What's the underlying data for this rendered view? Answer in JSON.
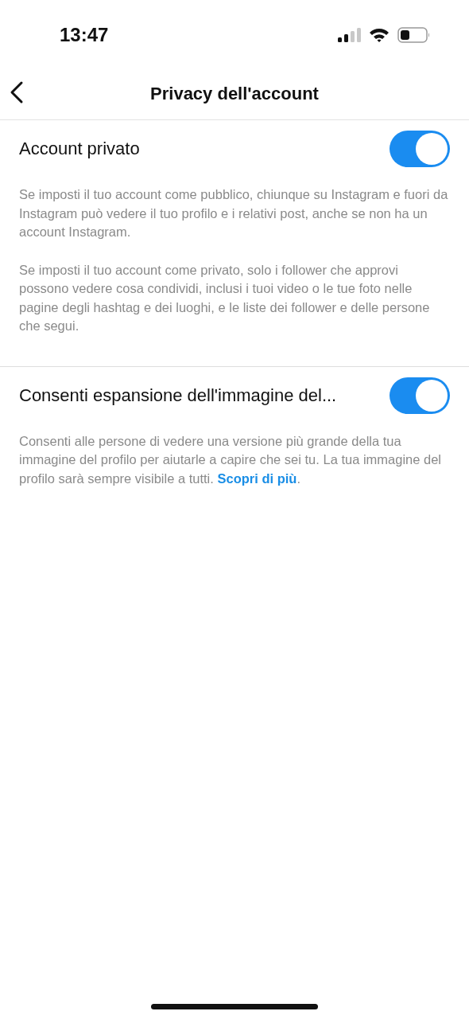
{
  "status_bar": {
    "time": "13:47"
  },
  "header": {
    "title": "Privacy dell'account"
  },
  "settings": [
    {
      "label": "Account privato",
      "on": true,
      "paragraphs": [
        "Se imposti il tuo account come pubblico, chiunque su Instagram e fuori da Instagram può vedere il tuo profilo e i relativi post, anche se non ha un account Instagram.",
        "Se imposti il tuo account come privato, solo i follower che approvi possono vedere cosa condividi, inclusi i tuoi video o le tue foto nelle pagine degli hashtag e dei luoghi, e le liste dei follower e delle persone che segui."
      ]
    },
    {
      "label": "Consenti espansione dell'immagine del...",
      "on": true,
      "paragraphs": [
        "Consenti alle persone di vedere una versione più grande della tua immagine del profilo per aiutarle a capire che sei tu. La tua immagine del profilo sarà sempre visibile a tutti."
      ],
      "link": "Scopri di più",
      "link_suffix": "."
    }
  ]
}
